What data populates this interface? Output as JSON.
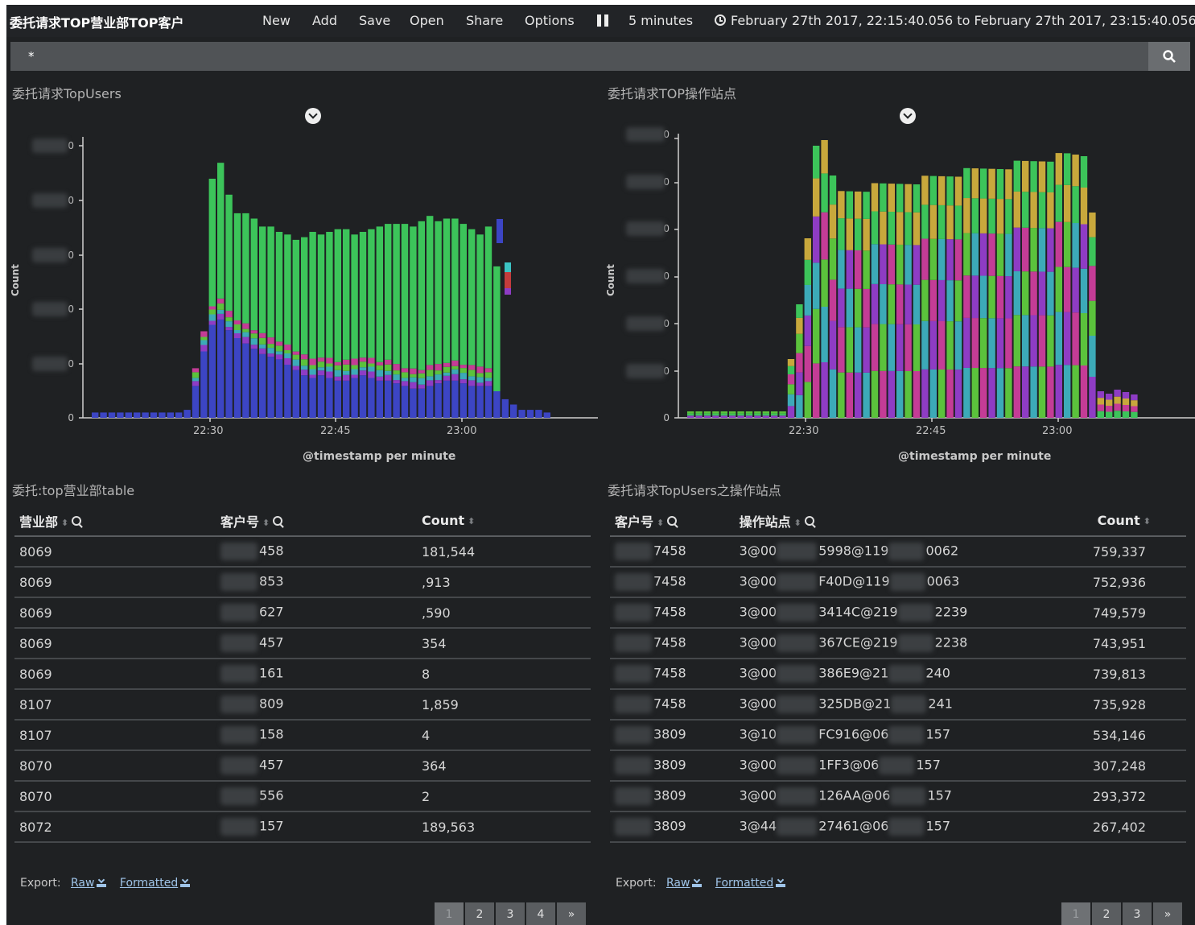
{
  "nav": {
    "dashboard_title": "委托请求TOP营业部TOP客户",
    "items": [
      "New",
      "Add",
      "Save",
      "Open",
      "Share",
      "Options"
    ],
    "refresh_interval": "5 minutes",
    "time_range": "February 27th 2017, 22:15:40.056 to February 27th 2017, 23:15:40.056"
  },
  "search": {
    "value": "*"
  },
  "panels": {
    "top_users_chart": {
      "title": "委托请求TopUsers"
    },
    "top_stations_chart": {
      "title": "委托请求TOP操作站点"
    },
    "branch_table": {
      "title": "委托:top营业部table"
    },
    "user_station_table": {
      "title": "委托请求TopUsers之操作站点"
    }
  },
  "chart_data": [
    {
      "type": "bar",
      "stacked": true,
      "ylabel": "Count",
      "xlabel": "@timestamp per minute",
      "x_ticks": [
        "22:30",
        "22:45",
        "23:00"
      ],
      "y_ticks": [
        "0",
        "0",
        "0",
        "0",
        "0",
        "0"
      ],
      "y_ticks_obscured": true,
      "grid": false,
      "colors": [
        "#3c45c4",
        "#8e3cc4",
        "#3caab8",
        "#5bc23c",
        "#c43c96",
        "#3cc45a"
      ],
      "series_values": {
        "blue": [
          0.02,
          0.02,
          0.02,
          0.02,
          0.02,
          0.02,
          0.02,
          0.02,
          0.02,
          0.02,
          0.02,
          0.03,
          0.12,
          0.25,
          0.35,
          0.37,
          0.33,
          0.3,
          0.28,
          0.26,
          0.24,
          0.23,
          0.22,
          0.2,
          0.18,
          0.16,
          0.15,
          0.16,
          0.15,
          0.14,
          0.14,
          0.15,
          0.16,
          0.15,
          0.14,
          0.14,
          0.13,
          0.12,
          0.11,
          0.11,
          0.12,
          0.13,
          0.14,
          0.14,
          0.13,
          0.12,
          0.12,
          0.12,
          0.1,
          0.07,
          0.05,
          0.03,
          0.03,
          0.03,
          0.02,
          0.0
        ],
        "green_top": [
          0.0,
          0.0,
          0.0,
          0.0,
          0.0,
          0.0,
          0.0,
          0.0,
          0.0,
          0.0,
          0.0,
          0.0,
          0.0,
          0.0,
          0.9,
          0.96,
          0.84,
          0.77,
          0.77,
          0.75,
          0.72,
          0.72,
          0.7,
          0.69,
          0.67,
          0.68,
          0.7,
          0.69,
          0.7,
          0.71,
          0.71,
          0.69,
          0.7,
          0.71,
          0.72,
          0.73,
          0.73,
          0.73,
          0.72,
          0.74,
          0.76,
          0.74,
          0.75,
          0.75,
          0.73,
          0.71,
          0.69,
          0.72,
          0.57,
          0.0,
          0.0,
          0.0,
          0.0,
          0.0,
          0.0,
          0.0
        ]
      }
    },
    {
      "type": "bar",
      "stacked": true,
      "ylabel": "Count",
      "xlabel": "@timestamp per minute",
      "x_ticks": [
        "22:30",
        "22:45",
        "23:00"
      ],
      "y_ticks": [
        "0",
        "0",
        "0",
        "0",
        "0",
        "0",
        "0"
      ],
      "y_ticks_obscured": true,
      "grid": false,
      "colors": [
        "#8e3cc4",
        "#3caab8",
        "#5bc23c",
        "#c43c96",
        "#3cc45a",
        "#c8a83c",
        "#3c5ac4",
        "#c4643c"
      ]
    }
  ],
  "branch_table": {
    "columns": [
      "营业部",
      "客户号",
      "Count"
    ],
    "rows": [
      [
        "8069",
        "458",
        "181,544"
      ],
      [
        "8069",
        "853",
        ",913"
      ],
      [
        "8069",
        "627",
        ",590"
      ],
      [
        "8069",
        "457",
        "354"
      ],
      [
        "8069",
        "161",
        "8"
      ],
      [
        "8107",
        "809",
        "1,859"
      ],
      [
        "8107",
        "158",
        "4"
      ],
      [
        "8070",
        "457",
        "364"
      ],
      [
        "8070",
        "556",
        "2"
      ],
      [
        "8072",
        "157",
        "189,563"
      ]
    ],
    "export_label": "Export:",
    "export_raw": "Raw",
    "export_formatted": "Formatted",
    "pages": [
      "1",
      "2",
      "3",
      "4",
      "»"
    ]
  },
  "user_station_table": {
    "columns": [
      "客户号",
      "操作站点",
      "Count"
    ],
    "rows": [
      [
        "7458",
        "3@00",
        "5998@119",
        "0062",
        "759,337"
      ],
      [
        "7458",
        "3@00",
        "F40D@119",
        "0063",
        "752,936"
      ],
      [
        "7458",
        "3@00",
        "3414C@219",
        "2239",
        "749,579"
      ],
      [
        "7458",
        "3@00",
        "367CE@219",
        "2238",
        "743,951"
      ],
      [
        "7458",
        "3@00",
        "386E9@21",
        "240",
        "739,813"
      ],
      [
        "7458",
        "3@00",
        "325DB@21",
        "241",
        "735,928"
      ],
      [
        "3809",
        "3@10",
        "FC916@06",
        "157",
        "534,146"
      ],
      [
        "3809",
        "3@00",
        "1FF3@06",
        "157",
        "307,248"
      ],
      [
        "3809",
        "3@00",
        "126AA@06",
        "157",
        "293,372"
      ],
      [
        "3809",
        "3@44",
        "27461@06",
        "157",
        "267,402"
      ]
    ],
    "export_label": "Export:",
    "export_raw": "Raw",
    "export_formatted": "Formatted",
    "pages": [
      "1",
      "2",
      "3",
      "»"
    ]
  }
}
